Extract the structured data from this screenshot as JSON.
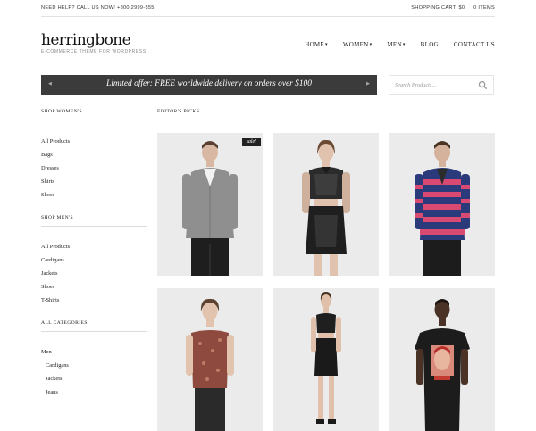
{
  "topbar": {
    "help": "NEED HELP? CALL US NOW! +800 2999-555",
    "cart": "SHOPPING CART: $0",
    "items": "0 ITEMS"
  },
  "logo": {
    "name": "herringbone",
    "tagline": "E-COMMERCE THEME FOR WORDPRESS"
  },
  "nav": {
    "home": "HOME",
    "women": "WOMEN",
    "men": "MEN",
    "blog": "BLOG",
    "contact": "CONTACT US"
  },
  "promo": {
    "text": "Limited offer: FREE worldwide delivery on orders over $100"
  },
  "search": {
    "placeholder": "Search Products..."
  },
  "sidebar": {
    "women_heading": "SHOP WOMEN'S",
    "women_items": [
      "All Products",
      "Bags",
      "Dresses",
      "Shirts",
      "Shoes"
    ],
    "men_heading": "SHOP MEN'S",
    "men_items": [
      "All Products",
      "Cardigans",
      "Jackets",
      "Shoes",
      "T-Shirts"
    ],
    "all_heading": "ALL CATEGORIES",
    "all_items": [
      "Men",
      "Cardigans",
      "Jackets",
      "Jeans"
    ]
  },
  "main": {
    "heading": "EDITOR'S PICKS",
    "sale_badge": "sale!"
  },
  "colors": {
    "promo_bg": "#3b3b3b",
    "card_bg": "#ebebeb",
    "badge_bg": "#222222"
  }
}
